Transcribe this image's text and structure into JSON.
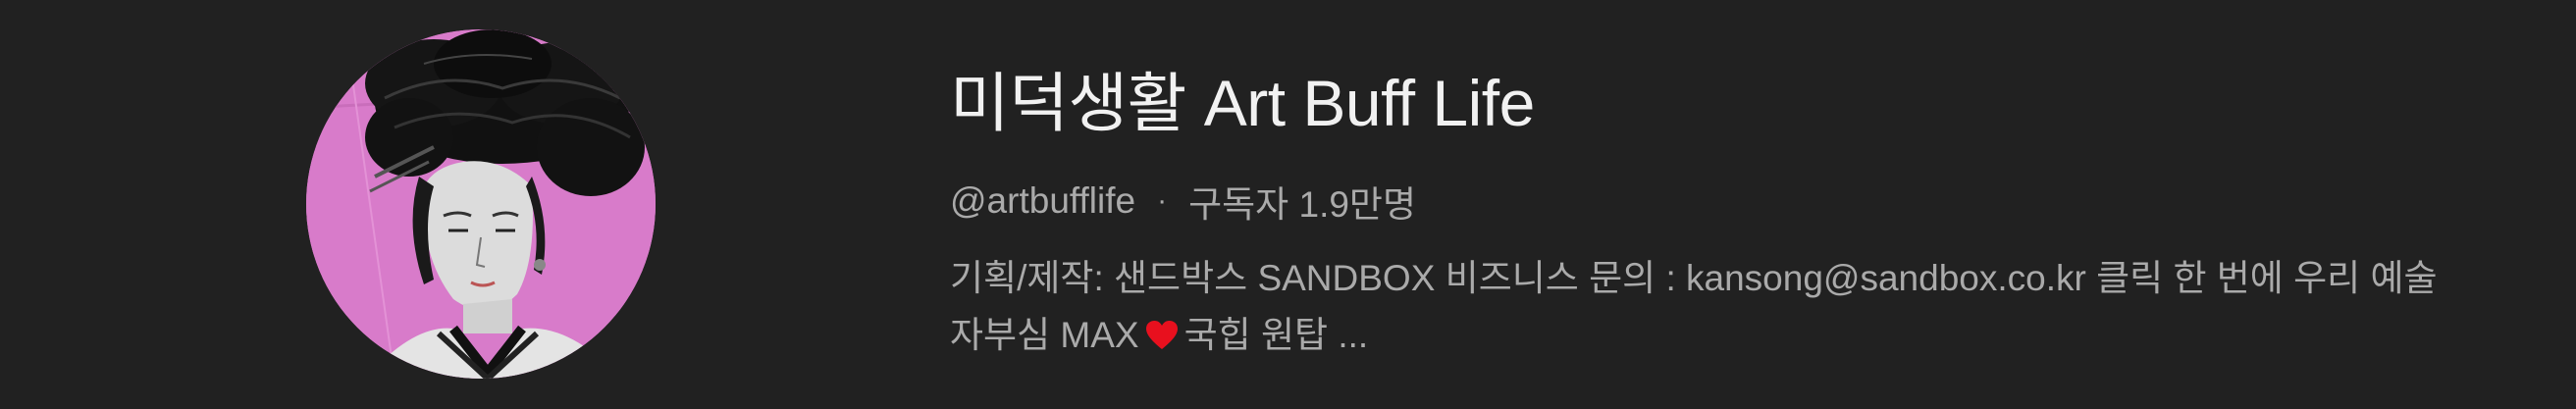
{
  "channel": {
    "name": "미덕생활 Art Buff Life",
    "handle": "@artbufflife",
    "separator": "·",
    "subscribers": "구독자 1.9만명",
    "description_line1": "기획/제작: 샌드박스 SANDBOX 비즈니스 문의 : kansong@sandbox.co.kr 클릭 한 번에 우리 예술",
    "description_line2_a": "자부심 MAX",
    "description_line2_b": "국힙 원탑 ..."
  },
  "icons": {
    "heart": "heart-icon"
  },
  "colors": {
    "background": "#212121",
    "title": "#f1f1f1",
    "secondary_text": "#aaaaaa",
    "avatar_bg": "#d77ac9",
    "heart": "#e8101e"
  }
}
